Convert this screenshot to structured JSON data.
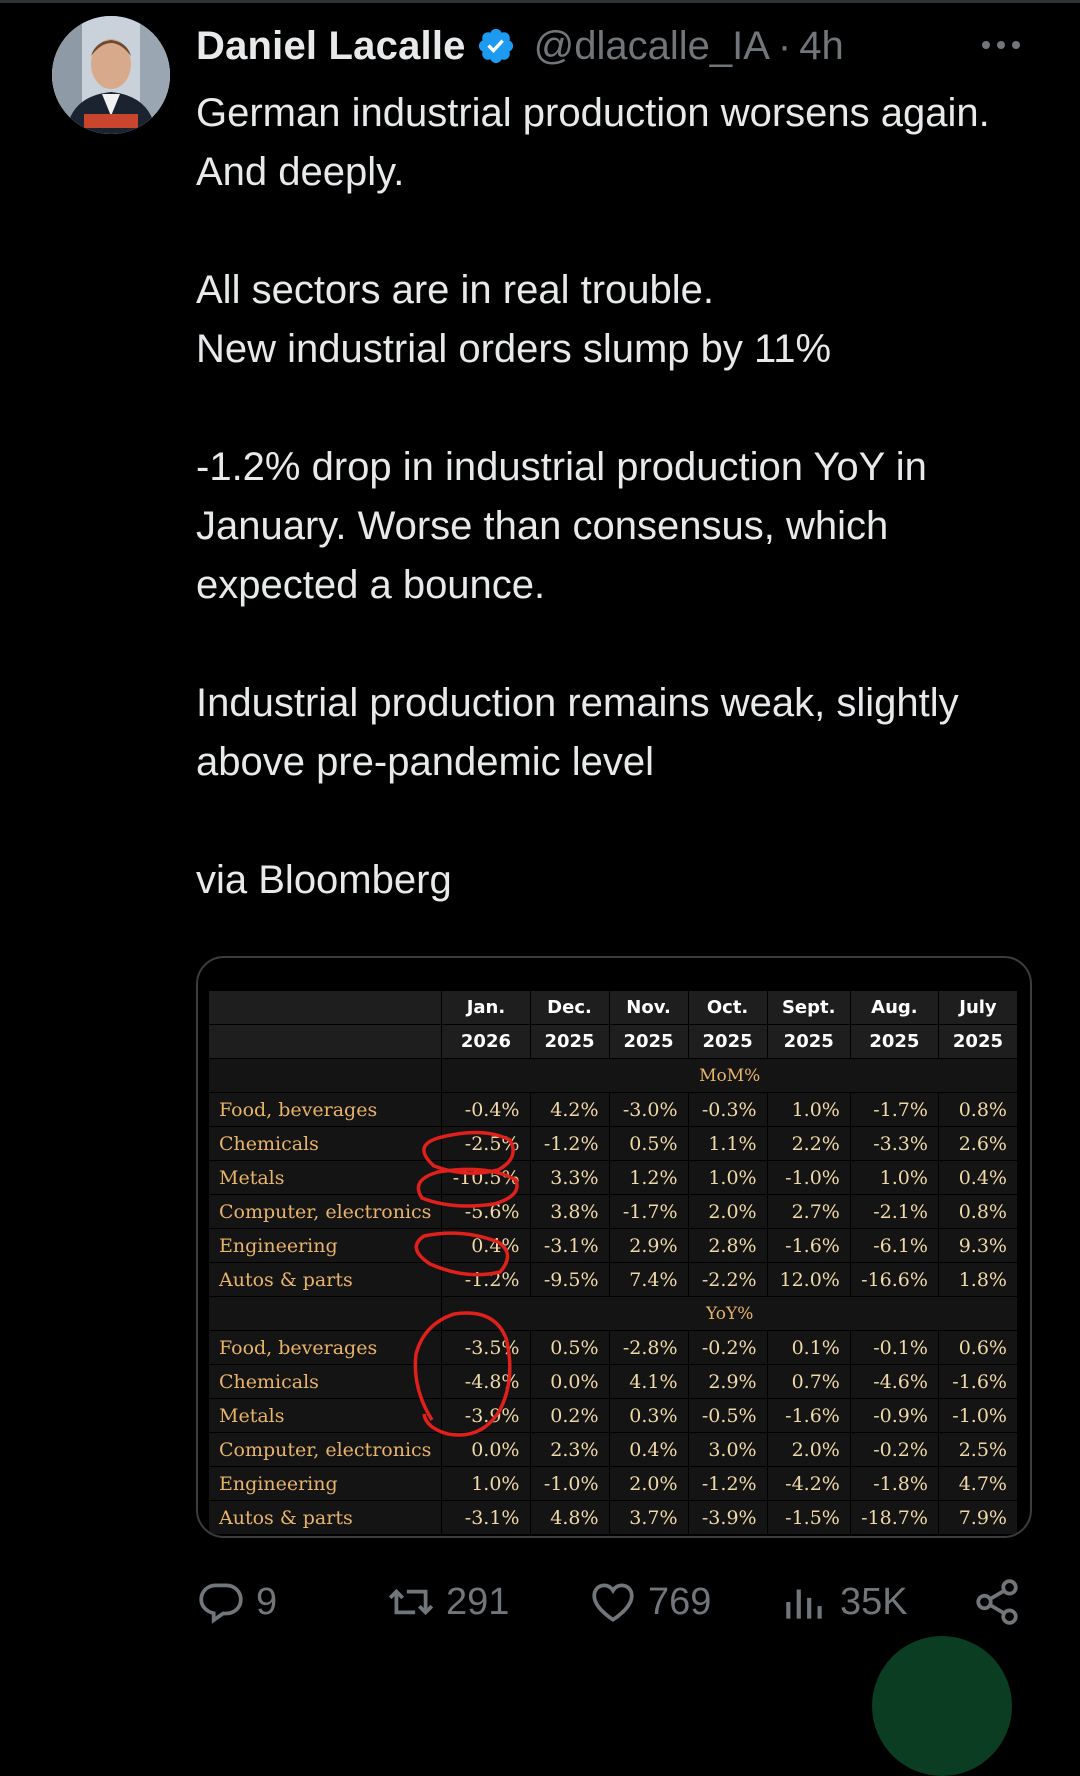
{
  "tweet": {
    "author_name": "Daniel Lacalle",
    "handle": "@dlacalle_IA",
    "separator": "·",
    "time": "4h",
    "text": "German industrial production worsens again. And deeply.\n\nAll sectors are in real trouble.\nNew industrial orders slump by 11%\n\n-1.2% drop in industrial production YoY in January. Worse than consensus, which expected a bounce.\n\nIndustrial production remains weak, slightly above pre-pandemic level\n\nvia Bloomberg"
  },
  "table": {
    "months": [
      "Jan.",
      "Dec.",
      "Nov.",
      "Oct.",
      "Sept.",
      "Aug.",
      "July"
    ],
    "years": [
      "2026",
      "2025",
      "2025",
      "2025",
      "2025",
      "2025",
      "2025"
    ],
    "sections": [
      {
        "title": "MoM%",
        "rows": [
          {
            "label": "Food, beverages",
            "values": [
              "-0.4%",
              "4.2%",
              "-3.0%",
              "-0.3%",
              "1.0%",
              "-1.7%",
              "0.8%"
            ]
          },
          {
            "label": "Chemicals",
            "values": [
              "-2.5%",
              "-1.2%",
              "0.5%",
              "1.1%",
              "2.2%",
              "-3.3%",
              "2.6%"
            ]
          },
          {
            "label": "Metals",
            "values": [
              "-10.5%",
              "3.3%",
              "1.2%",
              "1.0%",
              "-1.0%",
              "1.0%",
              "0.4%"
            ]
          },
          {
            "label": "Computer, electronics",
            "values": [
              "-5.6%",
              "3.8%",
              "-1.7%",
              "2.0%",
              "2.7%",
              "-2.1%",
              "0.8%"
            ]
          },
          {
            "label": "Engineering",
            "values": [
              "0.4%",
              "-3.1%",
              "2.9%",
              "2.8%",
              "-1.6%",
              "-6.1%",
              "9.3%"
            ]
          },
          {
            "label": "Autos & parts",
            "values": [
              "-1.2%",
              "-9.5%",
              "7.4%",
              "-2.2%",
              "12.0%",
              "-16.6%",
              "1.8%"
            ]
          }
        ]
      },
      {
        "title": "YoY%",
        "rows": [
          {
            "label": "Food, beverages",
            "values": [
              "-3.5%",
              "0.5%",
              "-2.8%",
              "-0.2%",
              "0.1%",
              "-0.1%",
              "0.6%"
            ]
          },
          {
            "label": "Chemicals",
            "values": [
              "-4.8%",
              "0.0%",
              "4.1%",
              "2.9%",
              "0.7%",
              "-4.6%",
              "-1.6%"
            ]
          },
          {
            "label": "Metals",
            "values": [
              "-3.9%",
              "0.2%",
              "0.3%",
              "-0.5%",
              "-1.6%",
              "-0.9%",
              "-1.0%"
            ]
          },
          {
            "label": "Computer, electronics",
            "values": [
              "0.0%",
              "2.3%",
              "0.4%",
              "3.0%",
              "2.0%",
              "-0.2%",
              "2.5%"
            ]
          },
          {
            "label": "Engineering",
            "values": [
              "1.0%",
              "-1.0%",
              "2.0%",
              "-1.2%",
              "-4.2%",
              "-1.8%",
              "4.7%"
            ]
          },
          {
            "label": "Autos & parts",
            "values": [
              "-3.1%",
              "4.8%",
              "3.7%",
              "-3.9%",
              "-1.5%",
              "-18.7%",
              "7.9%"
            ]
          }
        ]
      }
    ]
  },
  "actions": {
    "replies": "9",
    "reposts": "291",
    "likes": "769",
    "views": "35K"
  },
  "colors": {
    "background": "#000000",
    "text": "#e7e9ea",
    "muted": "#71767b",
    "verified": "#1d9bf0",
    "annotation": "#e0201b"
  },
  "icons": [
    "verified-badge-icon",
    "more-icon",
    "reply-icon",
    "repost-icon",
    "like-icon",
    "views-icon",
    "share-icon"
  ]
}
